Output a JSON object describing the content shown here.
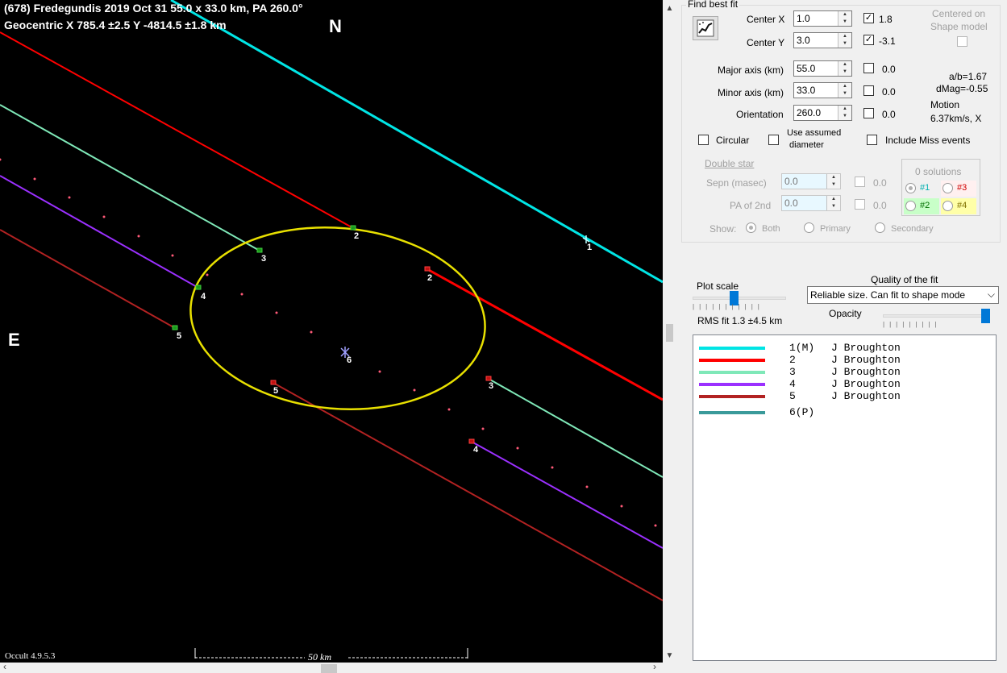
{
  "plot": {
    "title_line1": "(678) Fredegundis  2019 Oct 31  55.0 x 33.0 km, PA 260.0°",
    "title_line2": "Geocentric  X  785.4 ±2.5  Y -4814.5 ±1.8 km",
    "north_label": "N",
    "east_label": "E",
    "version": "Occult 4.9.5.3",
    "scale_label": "50 km",
    "chord_labels": [
      "1",
      "2",
      "3",
      "4",
      "5",
      "6"
    ],
    "colors": {
      "background": "#000000",
      "chord1": "#00e5e5",
      "chord2": "#ff0000",
      "chord3": "#7fe8b8",
      "chord4": "#9b30ff",
      "chord5": "#b22222",
      "ellipse": "#e8e000",
      "path_dots": "#ff5a78"
    }
  },
  "panel": {
    "group_title": "Find best fit",
    "center_x_label": "Center X",
    "center_x_value": "1.0",
    "center_x_check": "1.8",
    "center_y_label": "Center Y",
    "center_y_value": "3.0",
    "center_y_check": "-3.1",
    "centered_on": "Centered on",
    "shape_model": "Shape model",
    "major_label": "Major axis (km)",
    "major_value": "55.0",
    "major_check": "0.0",
    "minor_label": "Minor axis (km)",
    "minor_value": "33.0",
    "minor_check": "0.0",
    "orient_label": "Orientation",
    "orient_value": "260.0",
    "orient_check": "0.0",
    "ab_ratio": "a/b=1.67",
    "dmag": "dMag=-0.55",
    "motion_label": "Motion",
    "motion_value": "6.37km/s, X",
    "circular": "Circular",
    "use_assumed_1": "Use assumed",
    "use_assumed_2": "diameter",
    "include_miss": "Include Miss events",
    "double_star": "Double star",
    "sepn_label": "Sepn (masec)",
    "sepn_value": "0.0",
    "sepn_check": "0.0",
    "pa2_label": "PA of 2nd",
    "pa2_value": "0.0",
    "pa2_check": "0.0",
    "solutions_title": "0 solutions",
    "sol1": "#1",
    "sol2": "#2",
    "sol3": "#3",
    "sol4": "#4",
    "show_label": "Show:",
    "show_both": "Both",
    "show_primary": "Primary",
    "show_secondary": "Secondary",
    "plot_scale": "Plot scale",
    "quality_label": "Quality of the fit",
    "quality_value": "Reliable size. Can fit to shape mode",
    "opacity": "Opacity",
    "rms_fit": "RMS fit 1.3 ±4.5 km",
    "legend": [
      {
        "num": "1(M)",
        "observer": "J Broughton",
        "color": "#00e5e5"
      },
      {
        "num": "2",
        "observer": "J Broughton",
        "color": "#ff0000"
      },
      {
        "num": "3",
        "observer": "J Broughton",
        "color": "#7fe8b8"
      },
      {
        "num": "4",
        "observer": "J Broughton",
        "color": "#9b30ff"
      },
      {
        "num": "5",
        "observer": "J Broughton",
        "color": "#b22222"
      },
      {
        "num": "6(P)",
        "observer": "",
        "color": "#3a9a9a"
      }
    ]
  }
}
